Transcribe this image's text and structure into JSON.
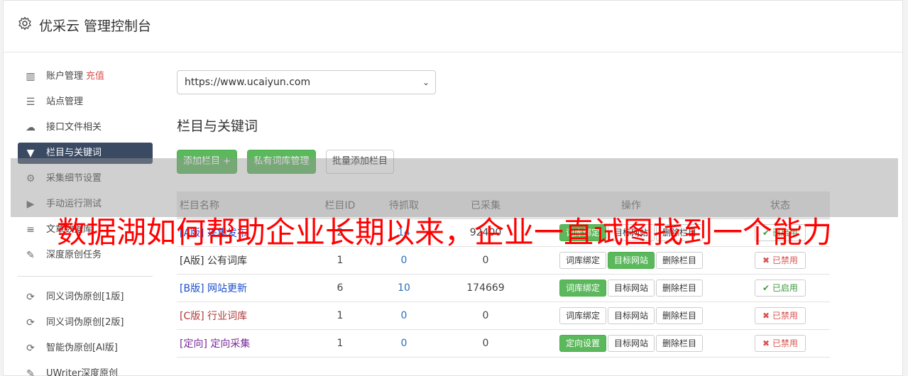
{
  "header": {
    "title": "优采云 管理控制台"
  },
  "sidebar": {
    "group1": [
      {
        "label": "账户管理",
        "extra": "充值",
        "icon": "bar-chart-icon",
        "glyph": "▥",
        "active": false
      },
      {
        "label": "站点管理",
        "icon": "server-icon",
        "glyph": "☰",
        "active": false
      },
      {
        "label": "接口文件相关",
        "icon": "cloud-upload-icon",
        "glyph": "☁",
        "active": false
      },
      {
        "label": "栏目与关键词",
        "icon": "filter-icon",
        "glyph": "▼",
        "active": true
      },
      {
        "label": "采集细节设置",
        "icon": "cogs-icon",
        "glyph": "⚙",
        "active": false
      },
      {
        "label": "手动运行测试",
        "icon": "play-circle-icon",
        "glyph": "▶",
        "active": false
      },
      {
        "label": "文章数据库",
        "icon": "database-icon",
        "glyph": "≡",
        "active": false
      },
      {
        "label": "深度原创任务",
        "icon": "edit-icon",
        "glyph": "✎",
        "active": false
      }
    ],
    "group2": [
      {
        "label": "同义词伪原创[1版]",
        "icon": "refresh-icon",
        "glyph": "⟳"
      },
      {
        "label": "同义词伪原创[2版]",
        "icon": "refresh-icon",
        "glyph": "⟳"
      },
      {
        "label": "智能伪原创[AI版]",
        "icon": "refresh-icon",
        "glyph": "⟳"
      },
      {
        "label": "UWriter深度原创",
        "icon": "edit-icon",
        "glyph": "✎"
      }
    ]
  },
  "main": {
    "site_select": "https://www.ucaiyun.com",
    "section_title": "栏目与关键词",
    "buttons": {
      "add": "添加栏目 +",
      "private_lib": "私有词库管理",
      "batch_add": "批量添加栏目"
    },
    "table": {
      "headers": [
        "栏目名称",
        "栏目ID",
        "待抓取",
        "已采集",
        "操作",
        "状态"
      ],
      "rows": [
        {
          "name": "[A版] 采集发布",
          "color": "c-blue",
          "id": "2",
          "pending": "14",
          "collected": "92400",
          "act1": "词库绑定",
          "act1_green": true,
          "act2": "目标网站",
          "act2_green": false,
          "act3": "删除栏目",
          "status": "已启用",
          "on": true
        },
        {
          "name": "[A版] 公有词库",
          "color": "c-gray",
          "id": "1",
          "pending": "0",
          "collected": "0",
          "act1": "词库绑定",
          "act1_green": false,
          "act2": "目标网站",
          "act2_green": true,
          "act3": "删除栏目",
          "status": "已禁用",
          "on": false
        },
        {
          "name": "[B版] 网站更新",
          "color": "c-blue",
          "id": "6",
          "pending": "10",
          "collected": "174669",
          "act1": "词库绑定",
          "act1_green": true,
          "act2": "目标网站",
          "act2_green": false,
          "act3": "删除栏目",
          "status": "已启用",
          "on": true
        },
        {
          "name": "[C版] 行业词库",
          "color": "c-red",
          "id": "1",
          "pending": "0",
          "collected": "0",
          "act1": "词库绑定",
          "act1_green": false,
          "act2": "目标网站",
          "act2_green": false,
          "act3": "删除栏目",
          "status": "已禁用",
          "on": false
        },
        {
          "name": "[定向] 定向采集",
          "color": "c-purple",
          "id": "1",
          "pending": "0",
          "collected": "0",
          "act1": "定向设置",
          "act1_green": true,
          "act2": "目标网站",
          "act2_green": false,
          "act3": "删除栏目",
          "status": "已禁用",
          "on": false
        }
      ]
    }
  },
  "overlay": {
    "text": "数据湖如何帮助企业长期以来，企业一直试图找到一个能力"
  }
}
